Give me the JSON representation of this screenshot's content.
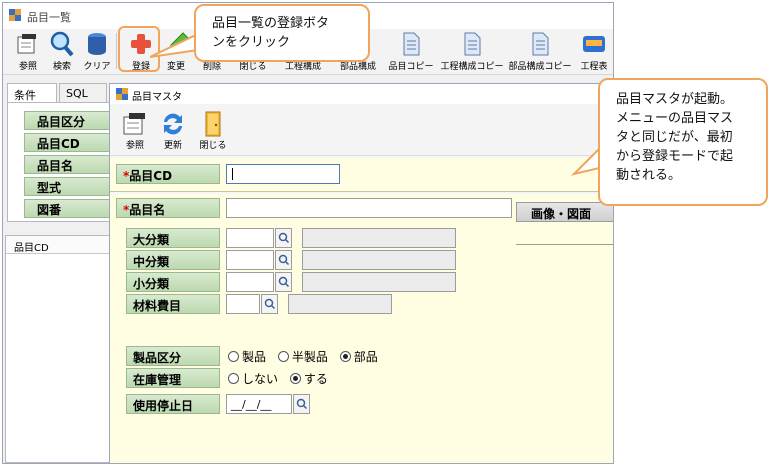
{
  "outer": {
    "title": "品目一覧",
    "toolbar": [
      {
        "id": "ref",
        "label": "参照"
      },
      {
        "id": "search",
        "label": "検索"
      },
      {
        "id": "clear",
        "label": "クリア"
      },
      {
        "id": "register",
        "label": "登録"
      },
      {
        "id": "change",
        "label": "変更"
      },
      {
        "id": "delete",
        "label": "削除"
      },
      {
        "id": "close",
        "label": "閉じる"
      },
      {
        "id": "process",
        "label": "工程構成"
      },
      {
        "id": "parts",
        "label": "部品構成"
      },
      {
        "id": "item_copy",
        "label": "品目コピー"
      },
      {
        "id": "process_copy",
        "label": "工程構成コピー"
      },
      {
        "id": "parts_copy",
        "label": "部品構成コピー"
      },
      {
        "id": "process_table",
        "label": "工程表"
      }
    ],
    "tabs": [
      "条件",
      "SQL"
    ],
    "conditions": [
      "品目区分",
      "品目CD",
      "品目名",
      "型式",
      "図番"
    ],
    "grid_header": "品目CD"
  },
  "inner": {
    "title": "品目マスタ",
    "toolbar": [
      {
        "id": "ref",
        "label": "参照"
      },
      {
        "id": "update",
        "label": "更新"
      },
      {
        "id": "close",
        "label": "閉じる"
      }
    ],
    "fields": {
      "item_cd": {
        "label": "品目CD",
        "required": "*",
        "value": ""
      },
      "item_name": {
        "label": "品目名",
        "required": "*",
        "value": ""
      },
      "large_class": "大分類",
      "middle_class": "中分類",
      "small_class": "小分類",
      "material_cost": "材料費目",
      "product_class": {
        "label": "製品区分",
        "options": [
          "製品",
          "半製品",
          "部品"
        ],
        "selected": "部品"
      },
      "stock_mgmt": {
        "label": "在庫管理",
        "options": [
          "しない",
          "する"
        ],
        "selected": "する"
      },
      "stop_date": {
        "label": "使用停止日",
        "value": "__/__/__"
      }
    },
    "image_header": "画像・図面"
  },
  "callouts": {
    "register": "品目一覧の登録ボタンをクリック",
    "register_line1": "品目一覧の登録ボタ",
    "register_line2": "ンをクリック",
    "master_line1": "品目マスタが起動。",
    "master_line2": "メニューの品目マス",
    "master_line3": "タと同じだが、最初",
    "master_line4": "から登録モードで起",
    "master_line5": "動される。"
  },
  "colors": {
    "accent": "#f0a45c",
    "label_green": "#c8e0bc",
    "pane": "#fffde2"
  }
}
